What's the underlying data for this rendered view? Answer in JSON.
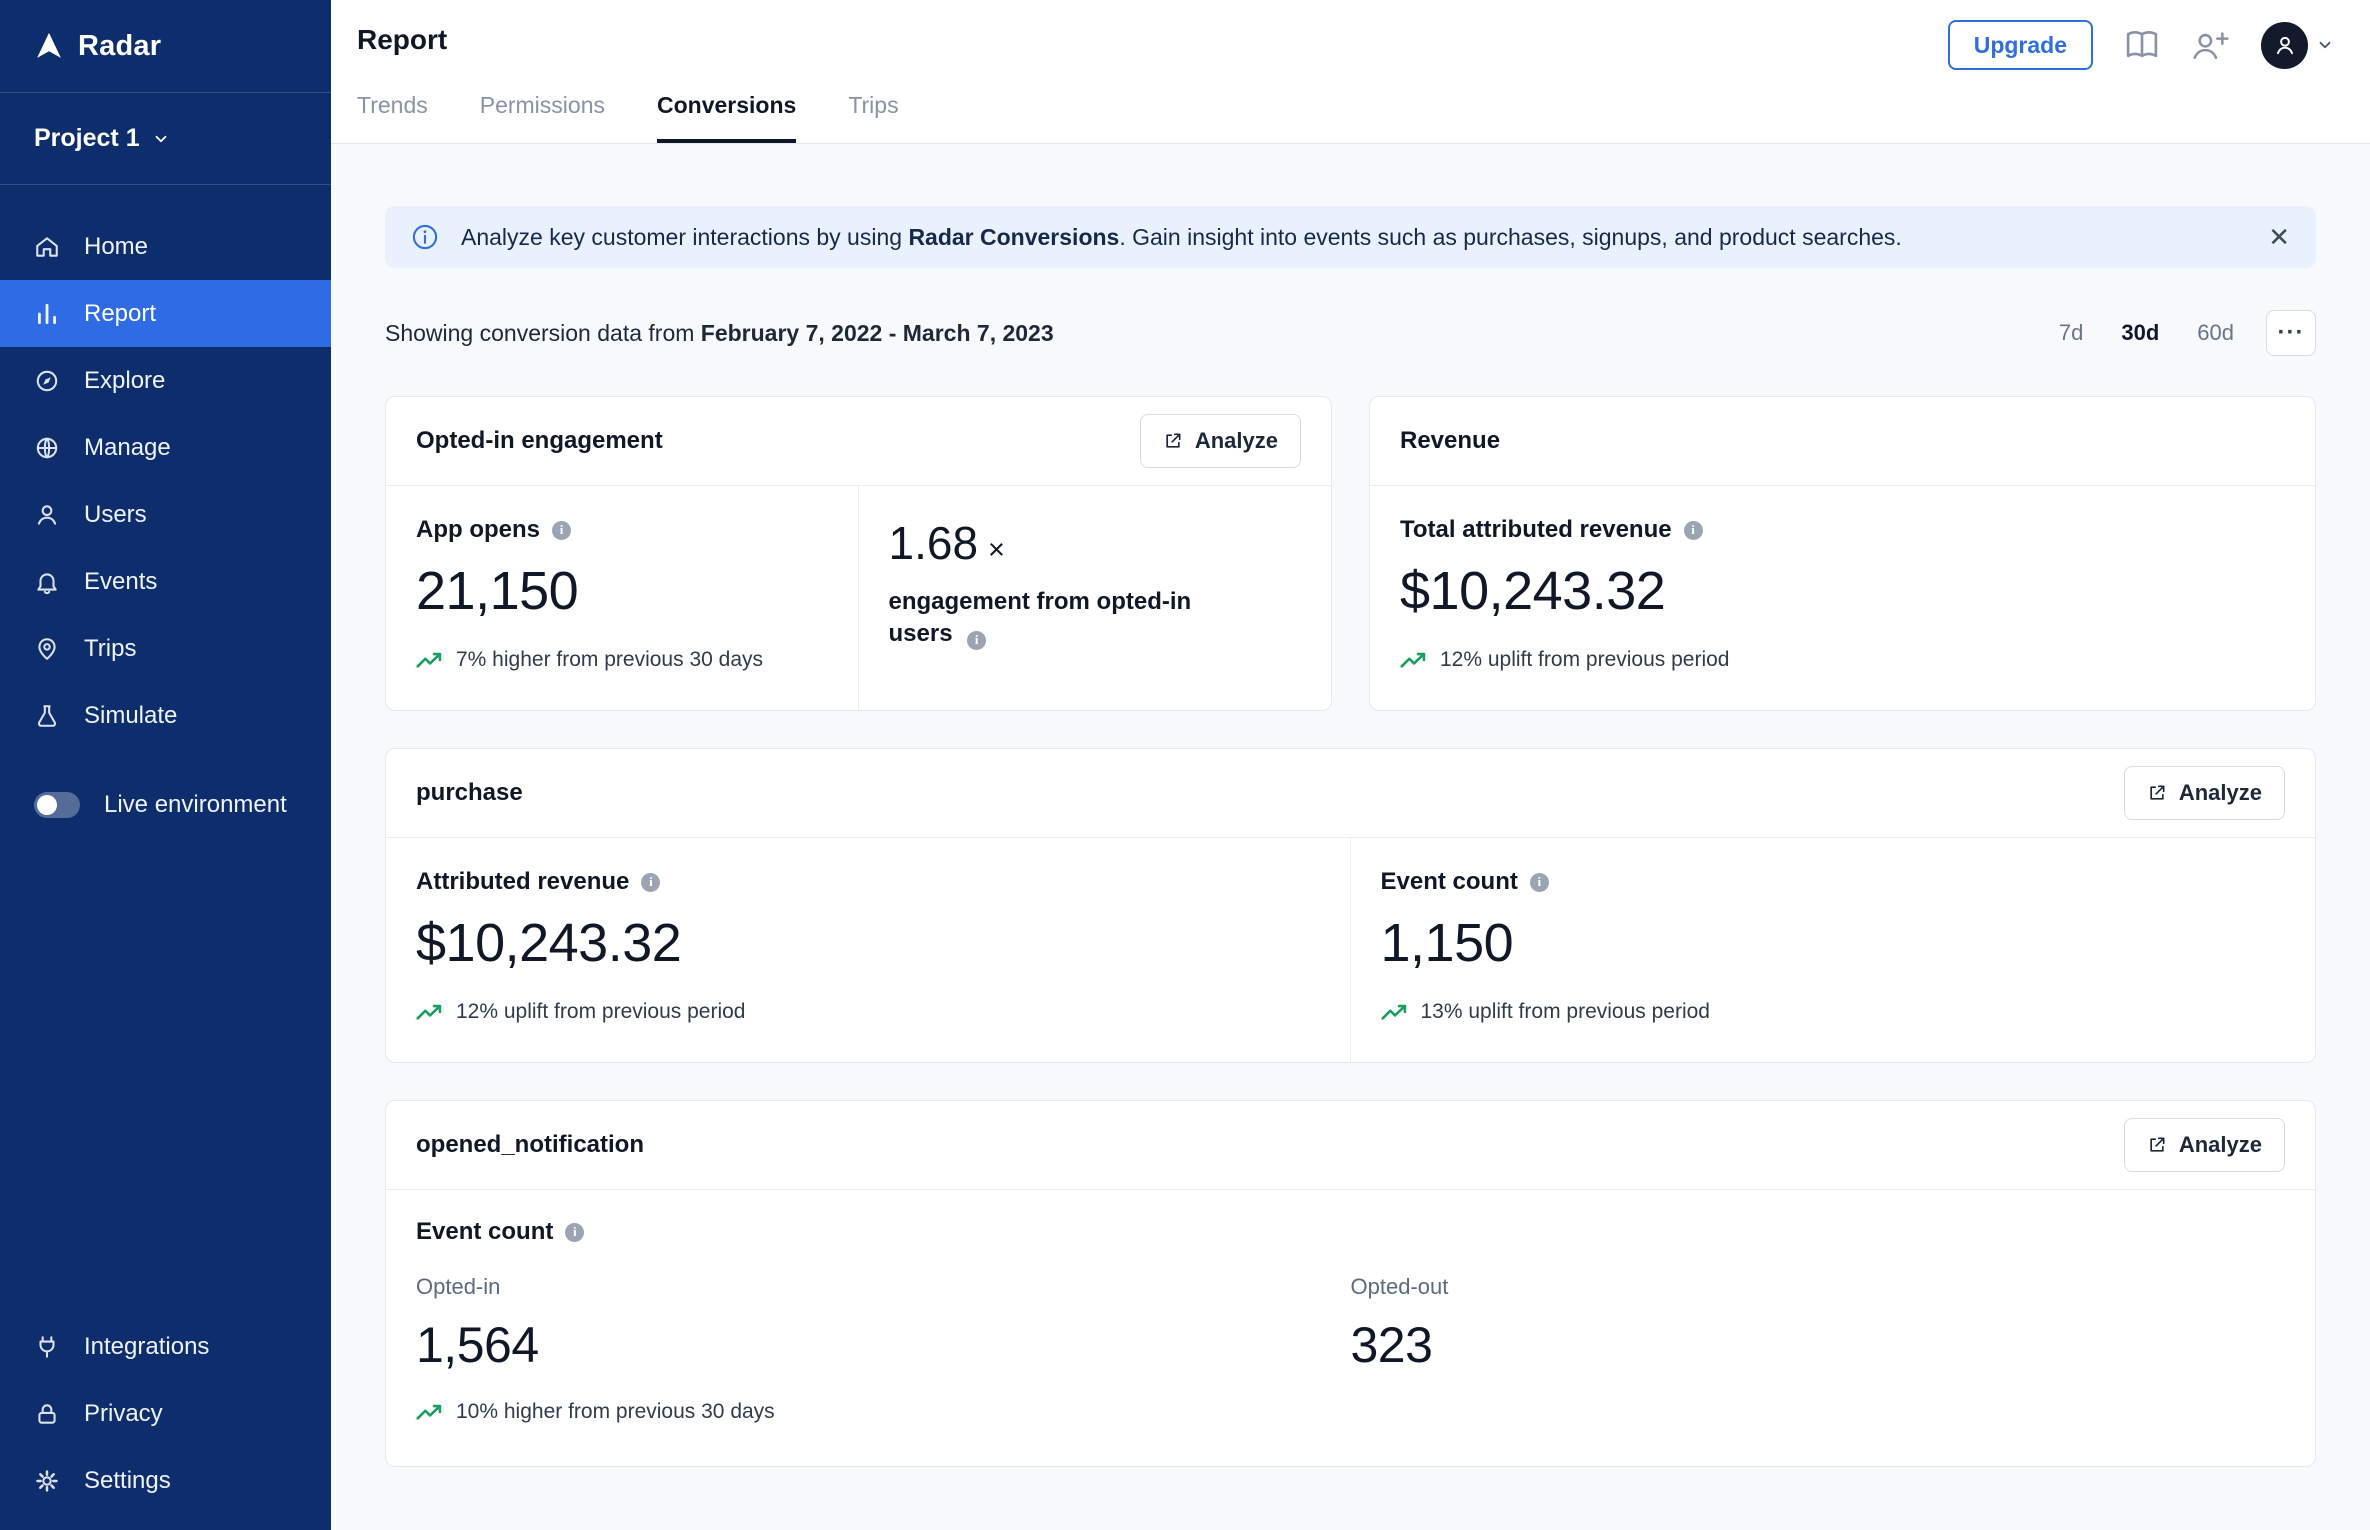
{
  "colors": {
    "brand_blue": "#2F6FE3",
    "sidebar_navy": "#0E2D6C",
    "positive_green": "#17A05C",
    "banner_bg": "#E8F1FD"
  },
  "icons": {
    "close_glyph": "✕",
    "more_glyph": "···"
  },
  "sidebar": {
    "brand": "Radar",
    "project": "Project 1",
    "items": [
      {
        "label": "Home"
      },
      {
        "label": "Report"
      },
      {
        "label": "Explore"
      },
      {
        "label": "Manage"
      },
      {
        "label": "Users"
      },
      {
        "label": "Events"
      },
      {
        "label": "Trips"
      },
      {
        "label": "Simulate"
      }
    ],
    "live_environment_label": "Live environment",
    "bottom_items": [
      {
        "label": "Integrations"
      },
      {
        "label": "Privacy"
      },
      {
        "label": "Settings"
      }
    ]
  },
  "header": {
    "title": "Report",
    "upgrade_label": "Upgrade",
    "tabs": [
      {
        "label": "Trends"
      },
      {
        "label": "Permissions"
      },
      {
        "label": "Conversions"
      },
      {
        "label": "Trips"
      }
    ],
    "active_tab": "Conversions"
  },
  "banner": {
    "text_pre": "Analyze key customer interactions by using ",
    "text_bold": "Radar Conversions",
    "text_post": ". Gain insight into events such as purchases, signups, and product searches."
  },
  "subheader": {
    "prefix": "Showing conversion data from ",
    "date_range": "February 7, 2022 - March 7, 2023",
    "ranges": [
      {
        "label": "7d"
      },
      {
        "label": "30d"
      },
      {
        "label": "60d"
      }
    ],
    "active_range": "30d"
  },
  "cards": {
    "opted_in_engagement": {
      "title": "Opted-in engagement",
      "analyze_label": "Analyze",
      "app_opens": {
        "label": "App opens",
        "value": "21,150",
        "trend": "7% higher from previous 30 days"
      },
      "engagement": {
        "value": "1.68",
        "multiplier": "×",
        "label": "engagement from opted-in users"
      }
    },
    "revenue": {
      "title": "Revenue",
      "metric": {
        "label": "Total attributed revenue",
        "value": "$10,243.32",
        "trend": "12% uplift from previous period"
      }
    },
    "purchase": {
      "title": "purchase",
      "analyze_label": "Analyze",
      "attributed_revenue": {
        "label": "Attributed revenue",
        "value": "$10,243.32",
        "trend": "12% uplift from previous period"
      },
      "event_count": {
        "label": "Event count",
        "value": "1,150",
        "trend": "13% uplift from previous period"
      }
    },
    "opened_notification": {
      "title": "opened_notification",
      "analyze_label": "Analyze",
      "section_label": "Event count",
      "opted_in": {
        "label": "Opted-in",
        "value": "1,564",
        "trend": "10% higher from previous 30 days"
      },
      "opted_out": {
        "label": "Opted-out",
        "value": "323"
      }
    }
  }
}
